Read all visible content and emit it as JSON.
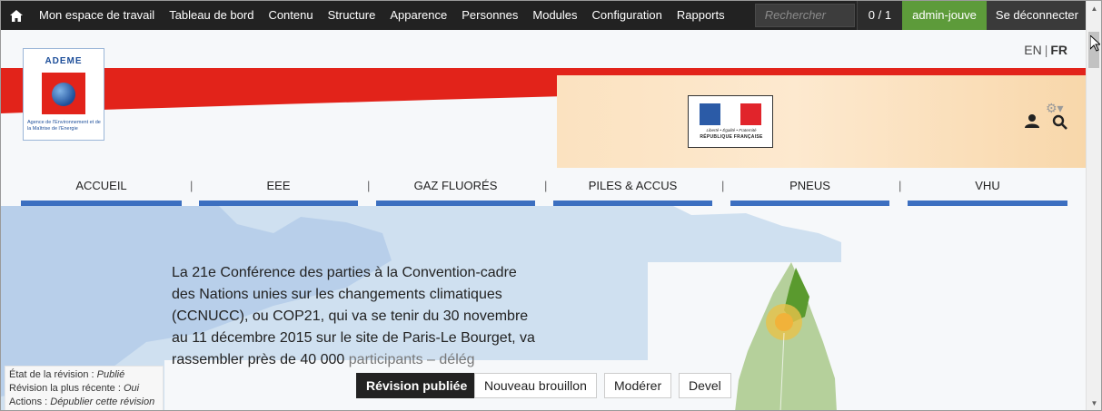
{
  "toolbar": {
    "items": [
      "Mon espace de travail",
      "Tableau de bord",
      "Contenu",
      "Structure",
      "Apparence",
      "Personnes",
      "Modules",
      "Configuration",
      "Rapports"
    ],
    "search_placeholder": "Rechercher",
    "count": "0 / 1",
    "user": "admin-jouve",
    "logout": "Se déconnecter"
  },
  "lang": {
    "en": "EN",
    "separator": "|",
    "fr": "FR"
  },
  "logo": {
    "title": "ADEME",
    "subtitle": "Agence de l'Environnement et de la Maîtrise de l'Energie"
  },
  "gov": {
    "motto": "Liberté • Égalité • Fraternité",
    "name": "RÉPUBLIQUE FRANÇAISE"
  },
  "nav": {
    "items": [
      "ACCUEIL",
      "EEE",
      "GAZ FLUORÉS",
      "PILES & ACCUS",
      "PNEUS",
      "VHU"
    ],
    "separator": "|"
  },
  "hero": {
    "text": "La 21e Conférence des parties à la Convention-cadre des Nations unies sur les changements climatiques (CCNUCC), ou COP21, qui va se tenir du 30 novembre au 11 décembre 2015 sur le site de Paris-Le Bourget, va rassembler près de 40 000",
    "text_faded": "participants – délég"
  },
  "revision": {
    "state_label": "État de la révision :",
    "state_value": "Publié",
    "latest_label": "Révision la plus récente :",
    "latest_value": "Oui",
    "actions_label": "Actions :",
    "actions_value": "Dépublier cette révision"
  },
  "buttons": {
    "published": "Révision publiée",
    "draft": "Nouveau brouillon",
    "moderate": "Modérer",
    "devel": "Devel"
  },
  "colors": {
    "toolbar_bg": "#222222",
    "user_bg": "#5d9b3a",
    "nav_underline": "#3c6fc0",
    "red_band": "#e2231a"
  }
}
